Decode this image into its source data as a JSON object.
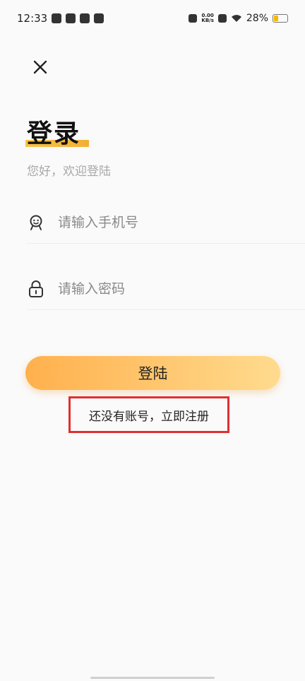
{
  "status_bar": {
    "time": "12:33",
    "net_speed_value": "0.00",
    "net_speed_unit": "KB/s",
    "battery": "28%"
  },
  "header": {
    "close_icon": "close-icon"
  },
  "login": {
    "title": "登录",
    "subtitle": "您好，欢迎登陆",
    "phone_placeholder": "请输入手机号",
    "password_placeholder": "请输入密码",
    "login_button": "登陆",
    "register_link": "还没有账号，立即注册"
  },
  "colors": {
    "accent_start": "#ffb04d",
    "accent_end": "#ffdb8e",
    "highlight_border": "#e02f2f"
  }
}
